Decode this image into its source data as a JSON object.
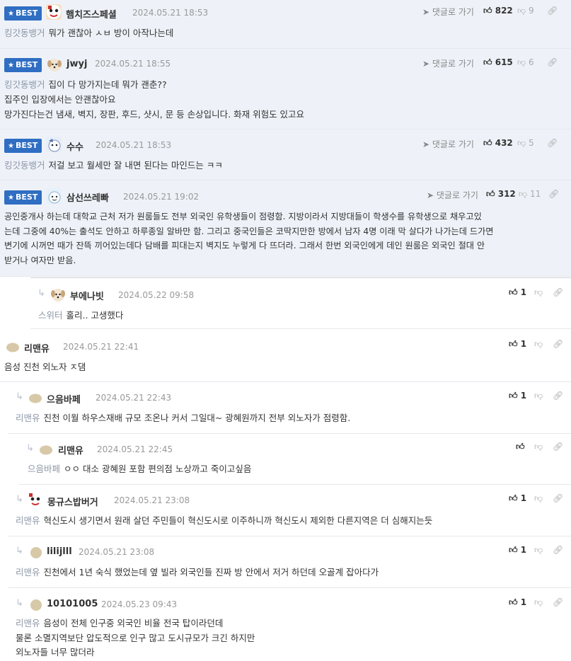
{
  "ui": {
    "best_label": "BEST",
    "reply_label": "댓글로 가기"
  },
  "comments": [
    {
      "nick": "햄치즈스페셜",
      "date": "2024.05.21 18:53",
      "target": "킹갓동뱅거",
      "lines": [
        "뭐가 괜찮아 ㅅㅂ 방이 아작나는데"
      ],
      "up": "822",
      "down": "9"
    },
    {
      "nick": "jwyj",
      "date": "2024.05.21 18:55",
      "target": "킹갓동뱅거",
      "lines": [
        "집이 다 망가지는데 뭐가 괜춘??",
        "집주인 입장에서는 안괜찮아요",
        "망가진다는건 냄새, 벽지, 장판, 후드, 샷시, 문 등 손상입니다. 화재 위험도 있고요"
      ],
      "up": "615",
      "down": "6"
    },
    {
      "nick": "수수",
      "date": "2024.05.21 18:53",
      "target": "킹갓동뱅거",
      "lines": [
        "저걸 보고 월세만 잘 내면 된다는 마인드는 ㅋㅋ"
      ],
      "up": "432",
      "down": "5"
    },
    {
      "nick": "삼선쓰레빠",
      "date": "2024.05.21 19:02",
      "target": "",
      "lines": [
        "공인중개사 하는데 대학교 근처 저가 원룸들도 전부 외국인 유학생들이 점령함. 지방이라서 지방대들이 학생수를 유학생으로 채우고있",
        "는데 그중에 40%는 출석도 안하고 하루종일 알바만 함. 그리고 중국인들은 코딱지만한 방에서 남자 4명 이래 막 살다가 나가는데 드가면",
        "변기에 시꺼먼 때가 잔뜩 끼어있는데다 담배를 피대는지 벽지도 누렇게 다 뜨더라. 그래서 한번 외국인에게 데인 원룸은 외국인 절대 안",
        "받거나 여자만 받음."
      ],
      "up": "312",
      "down": "11"
    },
    {
      "nick": "부에나빗",
      "date": "2024.05.22 09:58",
      "target": "스위터",
      "lines": [
        "홀리.. 고생했다"
      ],
      "up": "1",
      "down": ""
    },
    {
      "nick": "리맨유",
      "date": "2024.05.21 22:41",
      "target": "",
      "lines": [
        "음성 진천 외노자 ㅈ댐"
      ],
      "up": "1",
      "down": ""
    },
    {
      "nick": "으음바페",
      "date": "2024.05.21 22:43",
      "target": "리맨유",
      "lines": [
        "진천 이월 하우스재배 규모 조온나 커서 그일대~ 광혜원까지 전부 외노자가 점령함."
      ],
      "up": "1",
      "down": ""
    },
    {
      "nick": "리맨유",
      "date": "2024.05.21 22:45",
      "target": "으음바페",
      "lines": [
        "ㅇㅇ 대소 광혜원 포함 편의점 노상까고 죽이고싶음"
      ],
      "up": "",
      "down": ""
    },
    {
      "nick": "몽규스밥버거",
      "date": "2024.05.21 23:08",
      "target": "리맨유",
      "lines": [
        "혁신도시 생기면서 원래 살던 주민들이 혁신도시로 이주하니까 혁신도시 제외한 다른지역은 더 심해지는듯"
      ],
      "up": "1",
      "down": ""
    },
    {
      "nick": "lilijlll",
      "date": "2024.05.21 23:08",
      "target": "리맨유",
      "lines": [
        "진천에서 1년 숙식 했었는데 옆 빌라 외국인들 진짜 방 안에서 저거 하던데 오골계 잡아다가"
      ],
      "up": "1",
      "down": ""
    },
    {
      "nick": "10101005",
      "date": "2024.05.23 09:43",
      "target": "리맨유",
      "lines": [
        "음성이 전체 인구중 외국인 비율 전국 탑이라던데",
        "물론 소멸지역보단 압도적으로 인구 많고 도시규모가 크긴 하지만",
        "외노자들 너무 많더라"
      ],
      "up": "1",
      "down": ""
    }
  ]
}
